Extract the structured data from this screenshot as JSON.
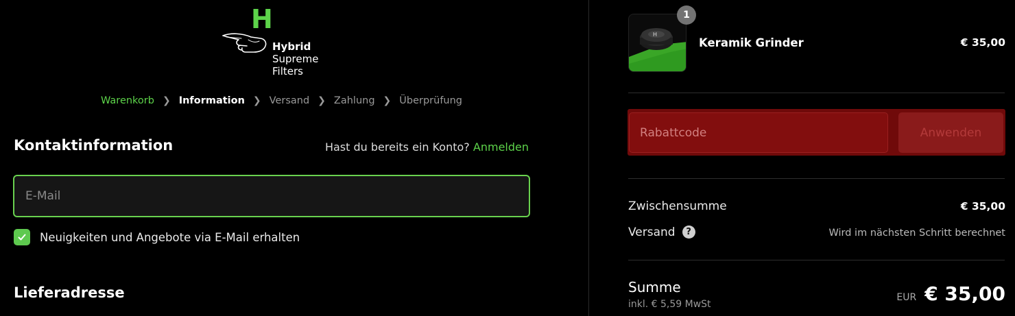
{
  "brand": {
    "letter": "H",
    "name_line1": "Hybrid",
    "name_line2": "Supreme",
    "name_line3": "Filters",
    "accent_color": "#5dd34a"
  },
  "breadcrumb": {
    "items": [
      {
        "label": "Warenkorb",
        "state": "link"
      },
      {
        "label": "Information",
        "state": "current"
      },
      {
        "label": "Versand",
        "state": "upcoming"
      },
      {
        "label": "Zahlung",
        "state": "upcoming"
      },
      {
        "label": "Überprüfung",
        "state": "upcoming"
      }
    ],
    "separator_icon": "chevron-right-icon"
  },
  "contact": {
    "title": "Kontaktinformation",
    "account_prompt": "Hast du bereits ein Konto?",
    "login_link": "Anmelden",
    "email_placeholder": "E-Mail",
    "email_value": "",
    "newsletter_label": "Neuigkeiten und Angebote via E-Mail erhalten",
    "newsletter_checked": true
  },
  "shipping_section": {
    "title": "Lieferadresse"
  },
  "order": {
    "product": {
      "name": "Keramik Grinder",
      "price": "€ 35,00",
      "quantity": "1"
    },
    "discount": {
      "placeholder": "Rabattcode",
      "apply_label": "Anwenden"
    },
    "subtotal_label": "Zwischensumme",
    "subtotal_value": "€ 35,00",
    "shipping_label": "Versand",
    "shipping_note": "Wird im nächsten Schritt berechnet",
    "total_label": "Summe",
    "tax_note": "inkl. € 5,59 MwSt",
    "currency": "EUR",
    "total_value": "€ 35,00"
  }
}
